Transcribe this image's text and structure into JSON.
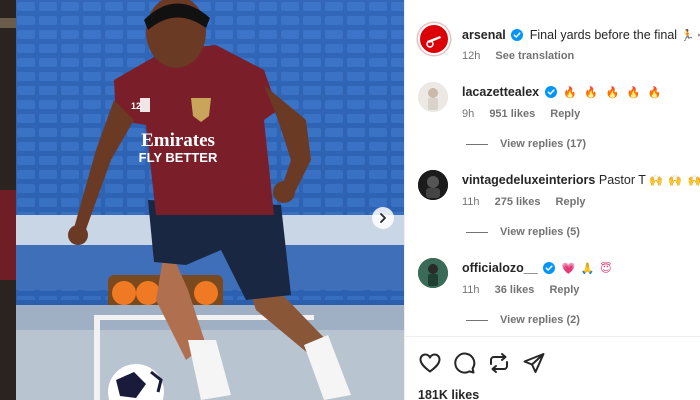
{
  "post": {
    "author": "arsenal",
    "caption": "Final yards before the final",
    "caption_emojis": "🏃 ✈",
    "time": "12h",
    "see_translation": "See translation"
  },
  "comments": [
    {
      "user": "lacazettealex",
      "text": "",
      "emojis": "🔥 🔥 🔥 🔥 🔥",
      "time": "9h",
      "likes": "951 likes",
      "reply": "Reply",
      "view_replies": "View replies (17)"
    },
    {
      "user": "vintagedeluxeinteriors",
      "text": "Pastor T",
      "emojis": "🙌 🙌 🙌",
      "time": "11h",
      "likes": "275 likes",
      "reply": "Reply",
      "view_replies": "View replies (5)"
    },
    {
      "user": "officialozo__",
      "text": "",
      "emojis": "💗 🙏 😇",
      "time": "11h",
      "likes": "36 likes",
      "reply": "Reply",
      "view_replies": "View replies (2)"
    }
  ],
  "photo": {
    "shirt_sponsor_line1": "Emirates",
    "shirt_sponsor_line2": "FLY BETTER",
    "shirt_number": "12"
  },
  "likes_total": "181K likes",
  "icons": [
    "heart-icon",
    "comment-icon",
    "share-icon",
    "send-icon",
    "chevron-right-icon",
    "verified-icon"
  ],
  "colors": {
    "verified": "#0095f6",
    "arsenal_red": "#db0007",
    "kit_maroon": "#7a1e2a",
    "pitch_blue": "#2b5fae"
  }
}
